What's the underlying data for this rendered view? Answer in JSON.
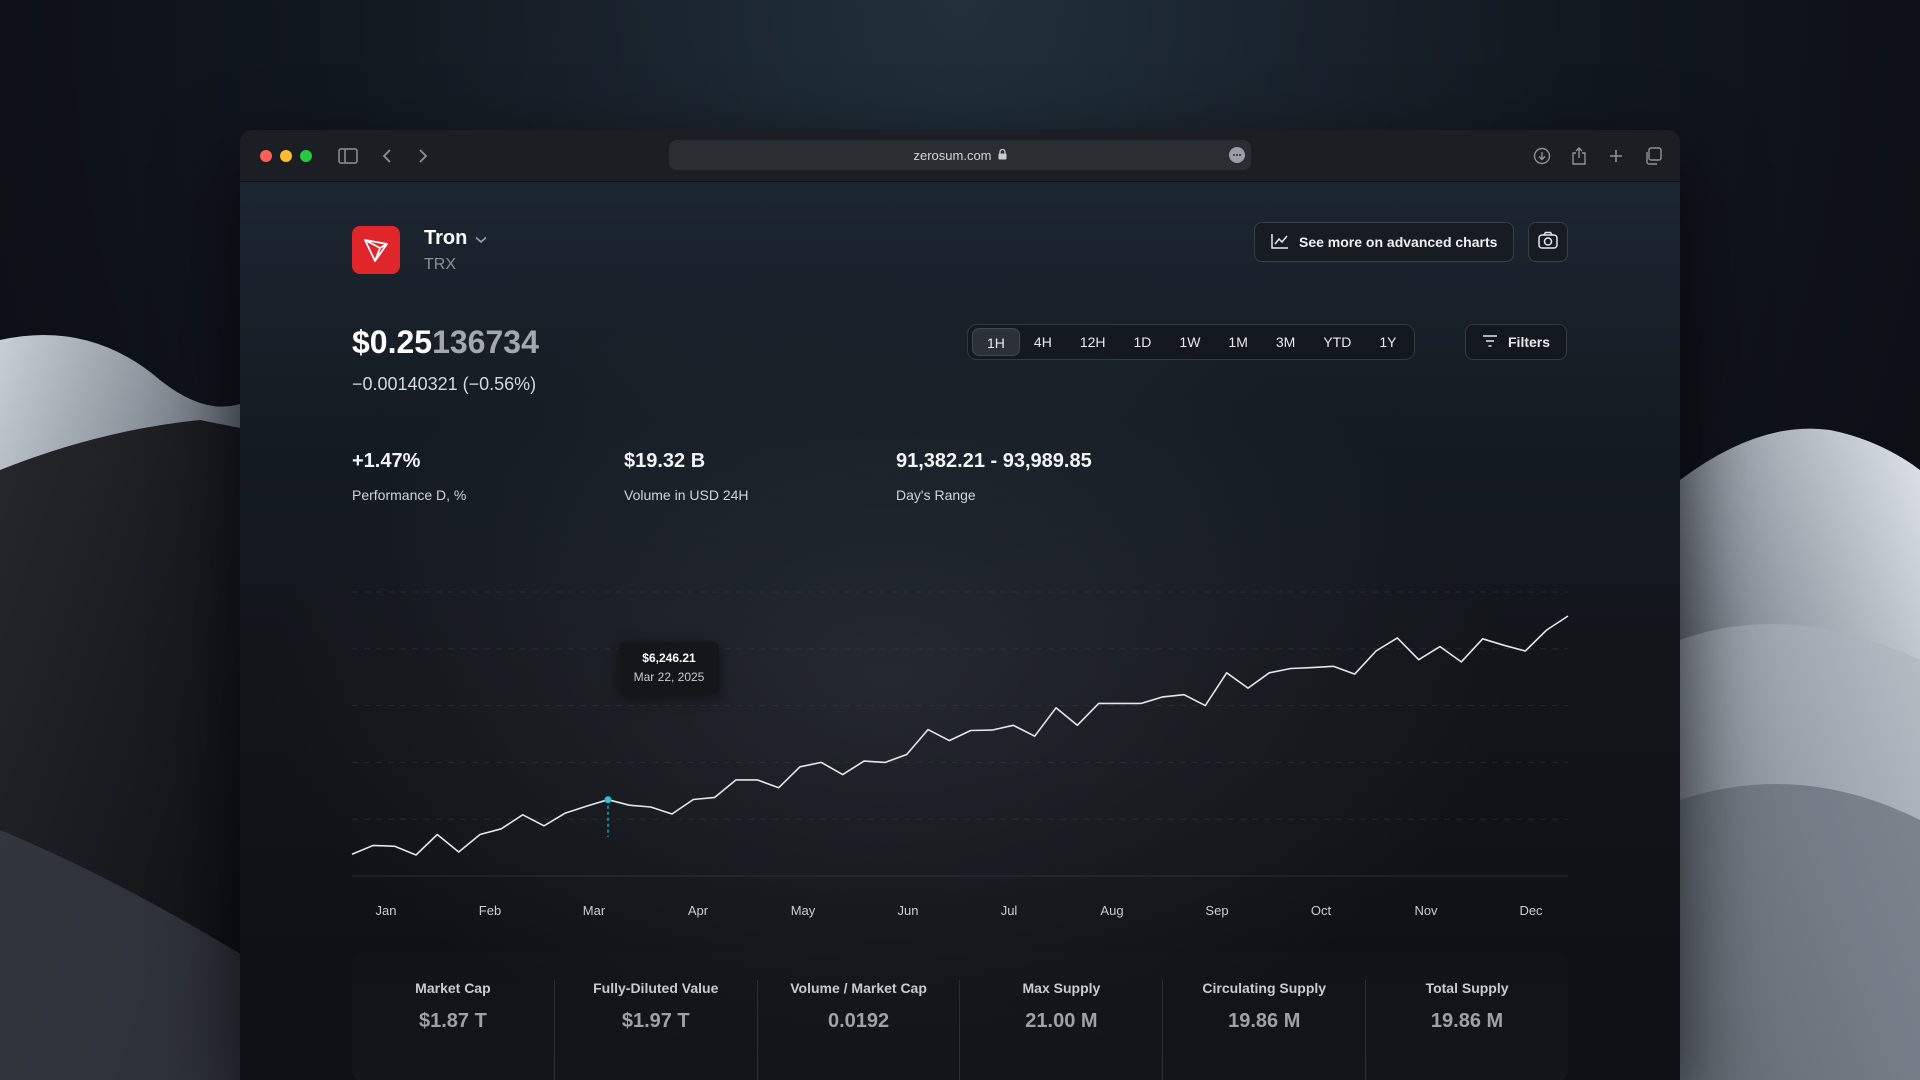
{
  "browser": {
    "url": "zerosum.com",
    "traffic_lights": [
      "#fe5f57",
      "#febc2e",
      "#28c840"
    ]
  },
  "coin": {
    "name": "Tron",
    "symbol": "TRX",
    "logo_color": "#e0262b",
    "icon": "tron-logo-icon"
  },
  "actions": {
    "advanced_charts_label": "See more on advanced charts",
    "screenshot_icon": "camera-icon",
    "filters_label": "Filters"
  },
  "price": {
    "main": "$0.25",
    "fade": "136734",
    "change": "−0.00140321 (−0.56%)"
  },
  "timeframes": {
    "options": [
      "1H",
      "4H",
      "12H",
      "1D",
      "1W",
      "1M",
      "3M",
      "YTD",
      "1Y"
    ],
    "active": "1H"
  },
  "stats": [
    {
      "value": "+1.47%",
      "label": "Performance D, %"
    },
    {
      "value": "$19.32 B",
      "label": "Volume in USD 24H"
    },
    {
      "value": "91,382.21 - 93,989.85",
      "label": "Day's Range"
    }
  ],
  "tooltip": {
    "value": "$6,246.21",
    "date": "Mar 22, 2025"
  },
  "chart_data": {
    "type": "line",
    "title": "",
    "xlabel": "",
    "ylabel": "",
    "months": [
      "Jan",
      "Feb",
      "Mar",
      "Apr",
      "May",
      "Jun",
      "Jul",
      "Aug",
      "Sep",
      "Oct",
      "Nov",
      "Dec"
    ],
    "values": [
      5000,
      5200,
      5180,
      4980,
      5450,
      5050,
      5450,
      5580,
      5900,
      5650,
      5940,
      6100,
      6246.21,
      6120,
      6080,
      5920,
      6250,
      6300,
      6700,
      6700,
      6520,
      7000,
      7100,
      6820,
      7130,
      7100,
      7280,
      7850,
      7600,
      7830,
      7840,
      7950,
      7700,
      8350,
      7950,
      8450,
      8450,
      8450,
      8600,
      8650,
      8400,
      9150,
      8800,
      9150,
      9250,
      9270,
      9300,
      9120,
      9650,
      9950,
      9450,
      9750,
      9400,
      9930,
      9780,
      9650,
      10130,
      10450
    ],
    "highlight_index": 12,
    "line_color": "#e4e6e9",
    "highlight_color": "#2bc4d6",
    "grid": true
  },
  "metrics": [
    {
      "label": "Market Cap",
      "value": "$1.87 T"
    },
    {
      "label": "Fully-Diluted Value",
      "value": "$1.97 T"
    },
    {
      "label": "Volume / Market Cap",
      "value": "0.0192"
    },
    {
      "label": "Max Supply",
      "value": "21.00 M"
    },
    {
      "label": "Circulating Supply",
      "value": "19.86 M"
    },
    {
      "label": "Total Supply",
      "value": "19.86 M"
    }
  ]
}
